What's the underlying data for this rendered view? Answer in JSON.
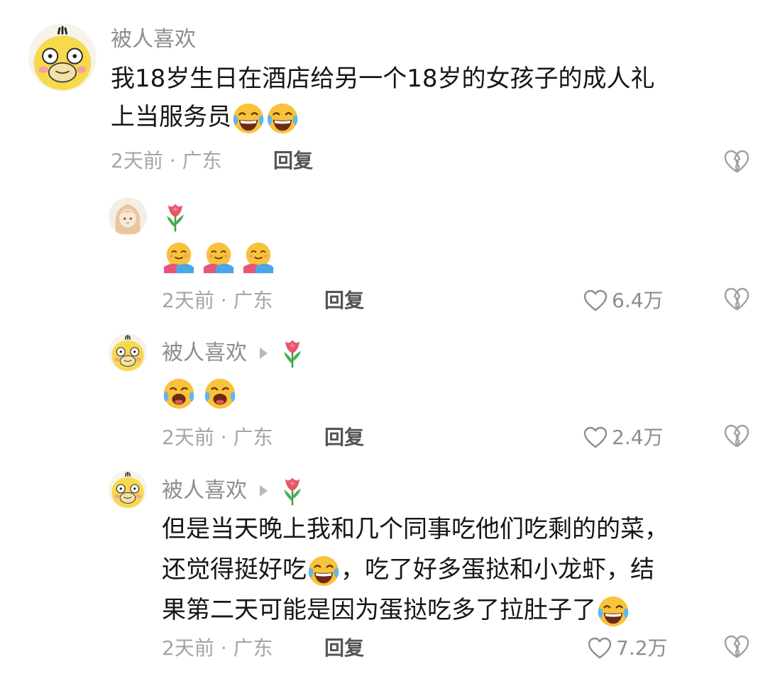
{
  "comment1": {
    "author": "被人喜欢",
    "text_line1": "我18岁生日在酒店给另一个18岁的女孩子的成人礼",
    "text_line2": "上当服务员",
    "time_location": "2天前 · 广东",
    "reply_label": "回复"
  },
  "reply1": {
    "author_emoji": "tulip-emoji",
    "time_location": "2天前 · 广东",
    "reply_label": "回复",
    "likes": "6.4万"
  },
  "reply2": {
    "author": "被人喜欢",
    "time_location": "2天前 · 广东",
    "reply_label": "回复",
    "likes": "2.4万"
  },
  "reply3": {
    "author": "被人喜欢",
    "text_line1": "但是当天晚上我和几个同事吃他们吃剩的的菜，",
    "text_line2a": "还觉得挺好吃",
    "text_line2b": "，吃了好多蛋挞和小龙虾，结",
    "text_line3": "果第二天可能是因为蛋挞吃多了拉肚子了",
    "time_location": "2天前 · 广东",
    "reply_label": "回复",
    "likes": "7.2万"
  },
  "colors": {
    "meta": "#a5a5a5",
    "name": "#8d8d8d",
    "text": "#161616"
  }
}
